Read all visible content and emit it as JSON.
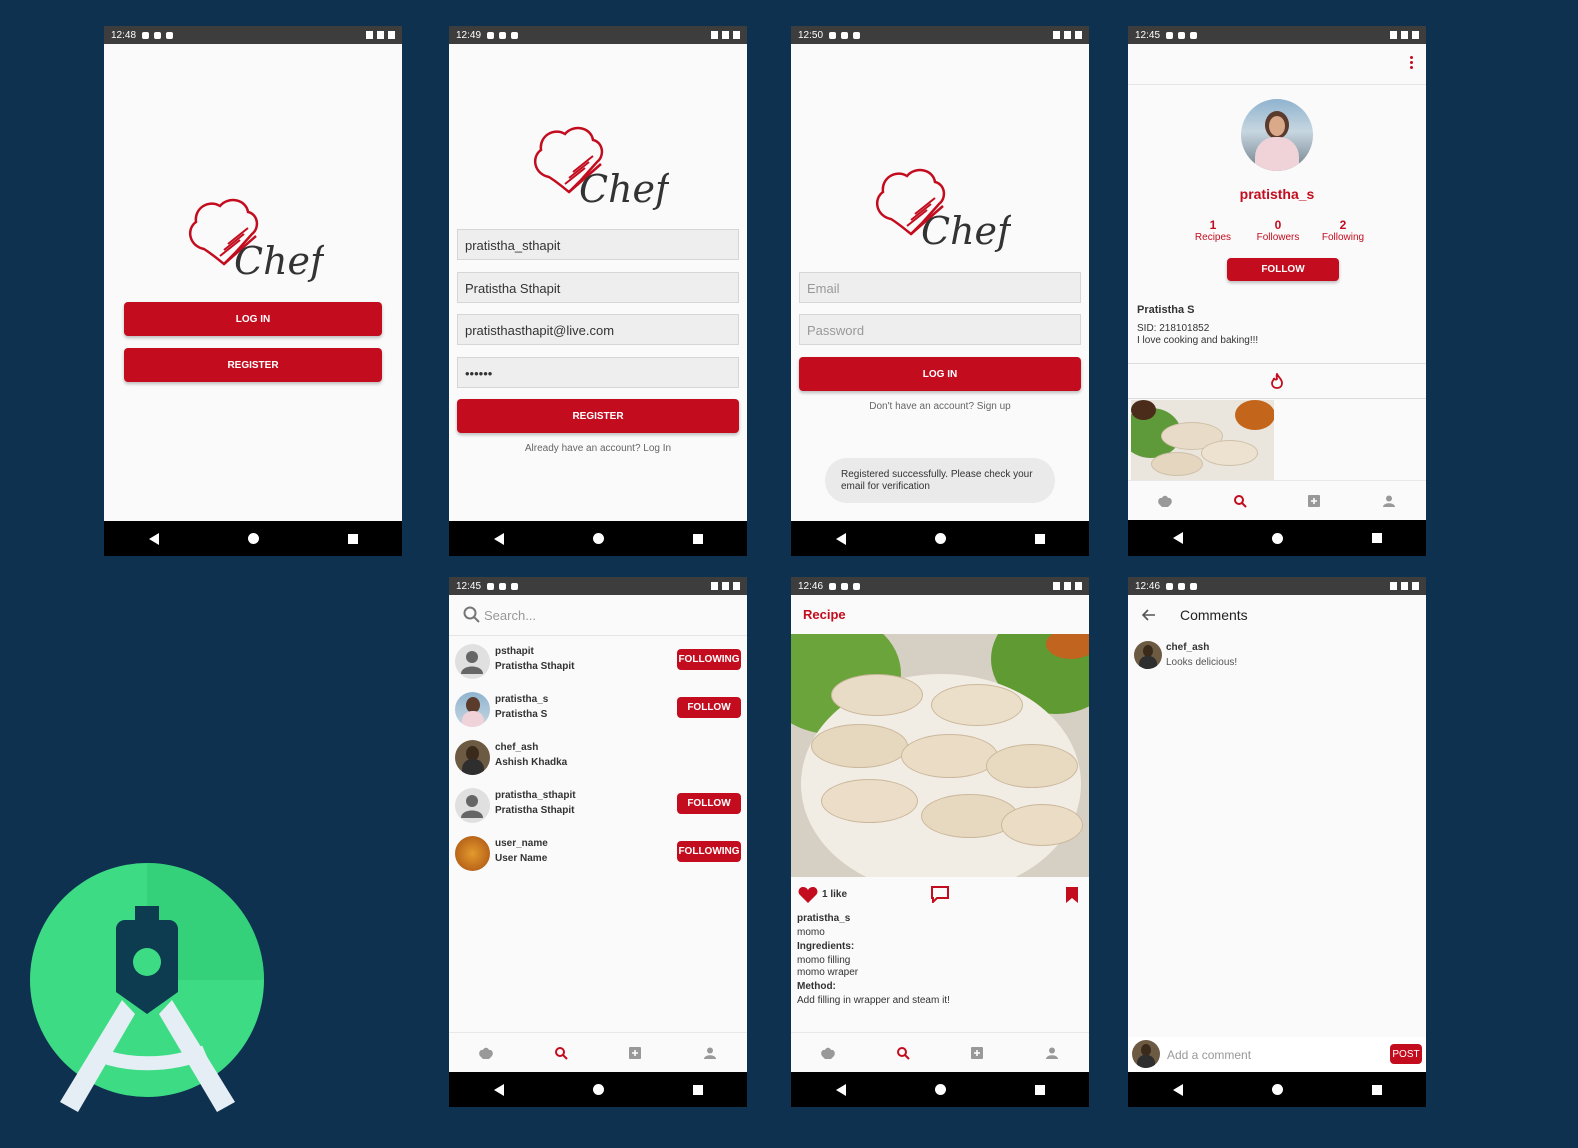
{
  "brand_color": "#c30d1f",
  "logo_text": "Chef",
  "screen1": {
    "time": "12:48",
    "login_button": "LOG IN",
    "register_button": "REGISTER"
  },
  "screen2": {
    "time": "12:49",
    "username": "pratistha_sthapit",
    "fullname": "Pratistha Sthapit",
    "email": "pratisthasthapit@live.com",
    "password": "••••••",
    "register_button": "REGISTER",
    "login_link": "Already have an account? Log In"
  },
  "screen3": {
    "time": "12:50",
    "email_placeholder": "Email",
    "password_placeholder": "Password",
    "login_button": "LOG IN",
    "signup_link": "Don't have an account? Sign up",
    "toast": "Registered successfully. Please check your email for verification"
  },
  "screen4": {
    "time": "12:45",
    "username": "pratistha_s",
    "stats": [
      {
        "value": "1",
        "label": "Recipes"
      },
      {
        "value": "0",
        "label": "Followers"
      },
      {
        "value": "2",
        "label": "Following"
      }
    ],
    "follow_button": "FOLLOW",
    "name": "Pratistha S",
    "sid": "SID: 218101852",
    "bio": "I love cooking and baking!!!"
  },
  "screen5": {
    "time": "12:45",
    "search_placeholder": "Search...",
    "users": [
      {
        "username": "psthapit",
        "fullname": "Pratistha Sthapit",
        "button": "FOLLOWING",
        "avatar": "default"
      },
      {
        "username": "pratistha_s",
        "fullname": "Pratistha S",
        "button": "FOLLOW",
        "avatar": "photo-woman"
      },
      {
        "username": "chef_ash",
        "fullname": "Ashish Khadka",
        "button": "",
        "avatar": "photo-man"
      },
      {
        "username": "pratistha_sthapit",
        "fullname": "Pratistha Sthapit",
        "button": "FOLLOW",
        "avatar": "default"
      },
      {
        "username": "user_name",
        "fullname": "User Name",
        "button": "FOLLOWING",
        "avatar": "photo-food"
      }
    ]
  },
  "screen6": {
    "time": "12:46",
    "title": "Recipe",
    "likes": "1 like",
    "author": "pratistha_s",
    "recipe_name": "momo",
    "ingredients_label": "Ingredients:",
    "ingredients": [
      "momo filling",
      "momo wraper"
    ],
    "method_label": "Method:",
    "method": "Add filling in wrapper and steam it!"
  },
  "screen7": {
    "time": "12:46",
    "title": "Comments",
    "comment_user": "chef_ash",
    "comment_text": "Looks delicious!",
    "input_placeholder": "Add a comment",
    "post_button": "POST"
  }
}
